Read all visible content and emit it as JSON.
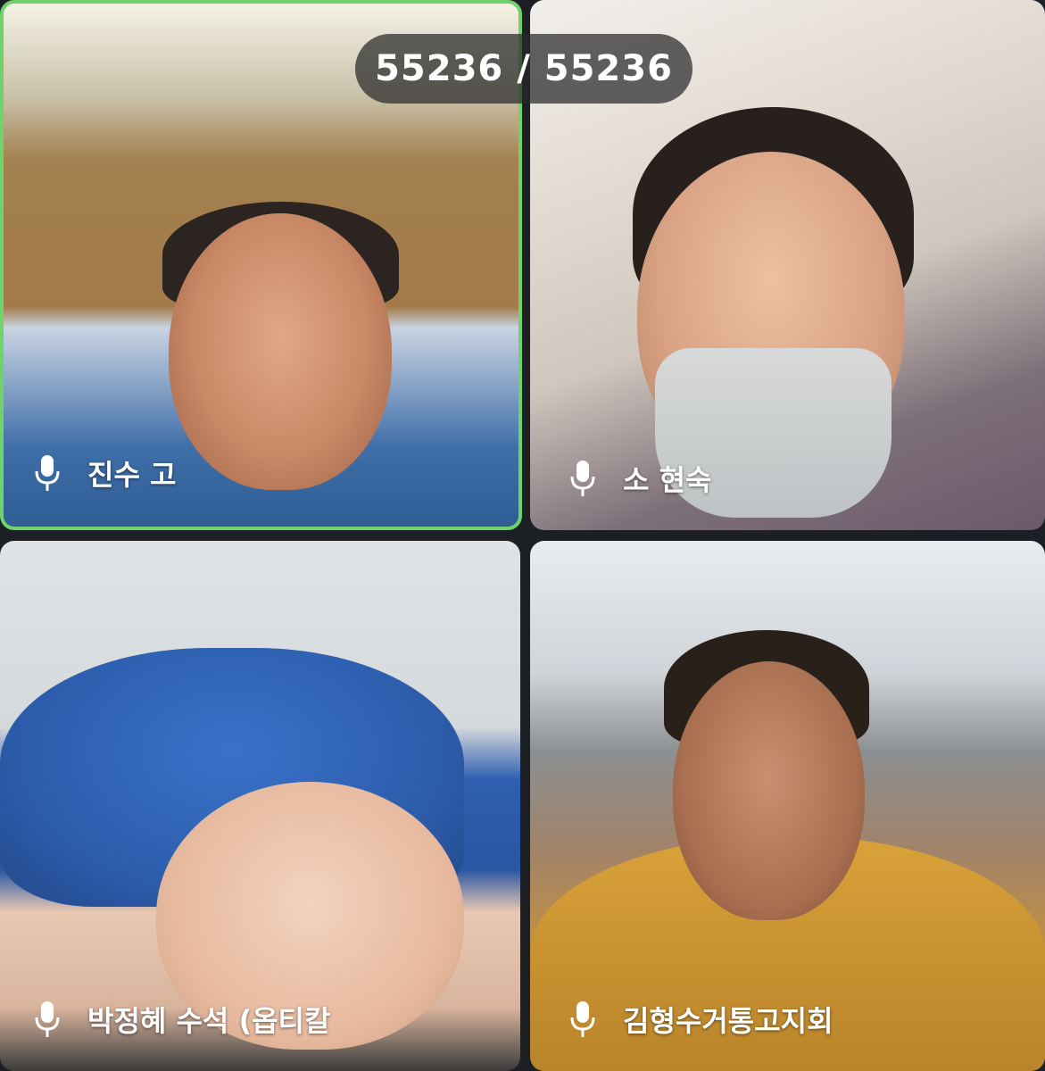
{
  "counter": {
    "current": "55236",
    "separator": " / ",
    "total": "55236"
  },
  "participants": [
    {
      "name": "진수 고",
      "mic_icon": "microphone-icon",
      "active_speaker": true
    },
    {
      "name": "소 현숙",
      "mic_icon": "microphone-icon",
      "active_speaker": false
    },
    {
      "name": "박정혜 수석 (옵티칼",
      "mic_icon": "microphone-icon",
      "active_speaker": false
    },
    {
      "name": "김형수거통고지회",
      "mic_icon": "microphone-icon",
      "active_speaker": false
    }
  ],
  "colors": {
    "active_speaker_border": "#6fd26b",
    "background": "#1c1f24",
    "label_text": "#ffffff"
  }
}
